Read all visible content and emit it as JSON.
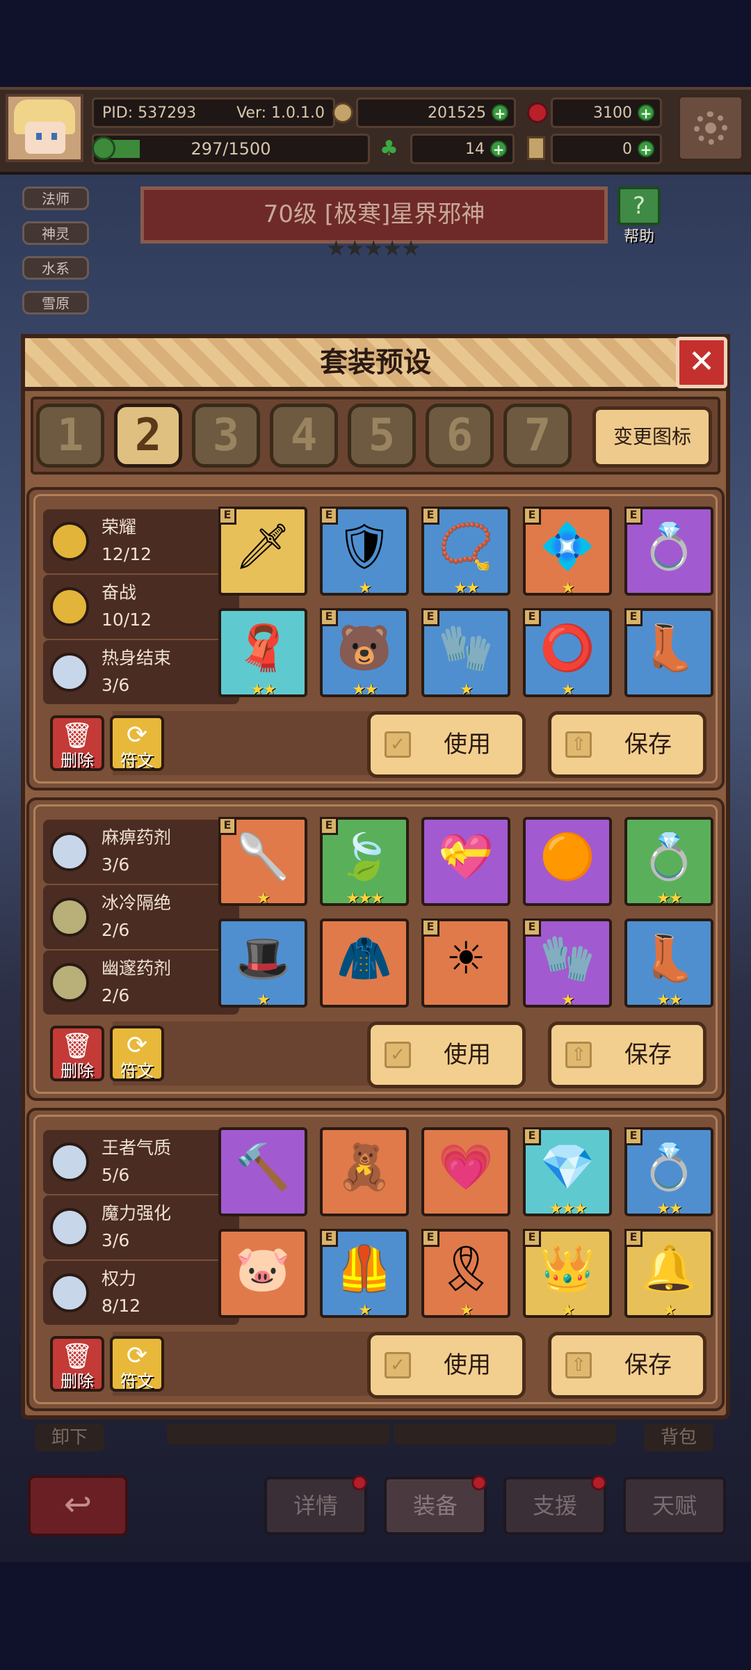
{
  "status": {
    "pid": "PID: 537293",
    "version": "Ver: 1.0.1.0",
    "gold": "201525",
    "gems": "3100",
    "exp": "297/1500",
    "clover": "14",
    "keys": "0"
  },
  "tags": [
    "法师",
    "神灵",
    "水系",
    "雪原"
  ],
  "boss": {
    "title": "70级  [极寒]星界邪神",
    "stars": "★★★★★",
    "help_label": "帮助"
  },
  "modal": {
    "title": "套装预设",
    "close_icon": "✕",
    "tabs": [
      "1",
      "2",
      "3",
      "4",
      "5",
      "6",
      "7"
    ],
    "active_tab": "2",
    "change_icon_label": "变更图标"
  },
  "presets": [
    {
      "sets": [
        {
          "name": "荣耀",
          "count": "12/12",
          "color": "#e2b43a"
        },
        {
          "name": "奋战",
          "count": "10/12",
          "color": "#e2b43a"
        },
        {
          "name": "热身结束",
          "count": "3/6",
          "color": "#c8d6ea"
        }
      ],
      "items": [
        {
          "icon": "🗡",
          "bg": "y",
          "e": true,
          "stars": ""
        },
        {
          "icon": "🛡",
          "bg": "b",
          "e": true,
          "stars": "★"
        },
        {
          "icon": "📿",
          "bg": "b",
          "e": true,
          "stars": "★★"
        },
        {
          "icon": "💠",
          "bg": "o",
          "e": true,
          "stars": "★"
        },
        {
          "icon": "💍",
          "bg": "p",
          "e": true,
          "stars": ""
        },
        {
          "icon": "🧣",
          "bg": "c",
          "e": false,
          "stars": "★★"
        },
        {
          "icon": "🐻",
          "bg": "b",
          "e": true,
          "stars": "★★"
        },
        {
          "icon": "🧤",
          "bg": "b",
          "e": true,
          "stars": "★"
        },
        {
          "icon": "⭕",
          "bg": "b",
          "e": true,
          "stars": "★"
        },
        {
          "icon": "👢",
          "bg": "b",
          "e": true,
          "stars": ""
        }
      ]
    },
    {
      "sets": [
        {
          "name": "麻痹药剂",
          "count": "3/6",
          "color": "#c8d6ea"
        },
        {
          "name": "冰冷隔绝",
          "count": "2/6",
          "color": "#b8b078"
        },
        {
          "name": "幽邃药剂",
          "count": "2/6",
          "color": "#b8b078"
        }
      ],
      "items": [
        {
          "icon": "🥄",
          "bg": "o",
          "e": true,
          "stars": "★"
        },
        {
          "icon": "🍃",
          "bg": "g",
          "e": true,
          "stars": "★★★"
        },
        {
          "icon": "💝",
          "bg": "p",
          "e": false,
          "stars": ""
        },
        {
          "icon": "🟠",
          "bg": "p",
          "e": false,
          "stars": ""
        },
        {
          "icon": "💍",
          "bg": "g",
          "e": false,
          "stars": "★★"
        },
        {
          "icon": "🎩",
          "bg": "b",
          "e": false,
          "stars": "★"
        },
        {
          "icon": "🧥",
          "bg": "o",
          "e": false,
          "stars": ""
        },
        {
          "icon": "☀",
          "bg": "o",
          "e": true,
          "stars": ""
        },
        {
          "icon": "🧤",
          "bg": "p",
          "e": true,
          "stars": "★"
        },
        {
          "icon": "👢",
          "bg": "b",
          "e": false,
          "stars": "★★"
        }
      ]
    },
    {
      "sets": [
        {
          "name": "王者气质",
          "count": "5/6",
          "color": "#c8d6ea"
        },
        {
          "name": "魔力强化",
          "count": "3/6",
          "color": "#c8d6ea"
        },
        {
          "name": "权力",
          "count": "8/12",
          "color": "#c8d6ea"
        }
      ],
      "items": [
        {
          "icon": "🔨",
          "bg": "p",
          "e": false,
          "stars": ""
        },
        {
          "icon": "🧸",
          "bg": "o",
          "e": false,
          "stars": ""
        },
        {
          "icon": "💗",
          "bg": "o",
          "e": false,
          "stars": ""
        },
        {
          "icon": "💎",
          "bg": "c",
          "e": true,
          "stars": "★★★"
        },
        {
          "icon": "💍",
          "bg": "b",
          "e": true,
          "stars": "★★"
        },
        {
          "icon": "🐷",
          "bg": "o",
          "e": false,
          "stars": ""
        },
        {
          "icon": "🦺",
          "bg": "b",
          "e": true,
          "stars": "★"
        },
        {
          "icon": "🎗",
          "bg": "o",
          "e": true,
          "stars": "★"
        },
        {
          "icon": "👑",
          "bg": "y",
          "e": true,
          "stars": "★"
        },
        {
          "icon": "🔔",
          "bg": "y",
          "e": true,
          "stars": "★"
        }
      ]
    }
  ],
  "buttons": {
    "delete": "删除",
    "rune": "符文",
    "use": "使用",
    "save": "保存"
  },
  "behind": {
    "unequip": "卸下",
    "bag": "背包"
  },
  "bottom_nav": [
    "详情",
    "装备",
    "支援",
    "天赋"
  ],
  "back_icon": "↩"
}
